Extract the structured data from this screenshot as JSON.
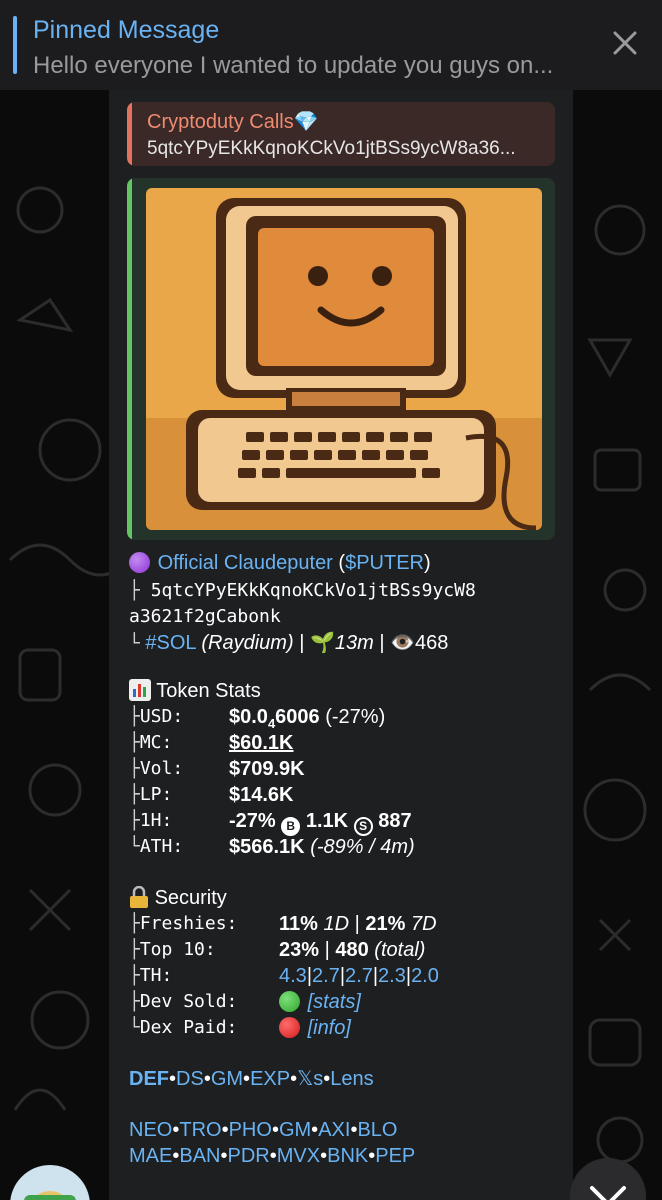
{
  "pinned": {
    "title": "Pinned Message",
    "preview": "Hello everyone I wanted to update you guys on..."
  },
  "reply": {
    "name": "Cryptoduty Calls",
    "text": "5qtcYPyEKkKqnoKCkVo1jtBSs9ycW8a36..."
  },
  "token": {
    "name": "Official Claudeputer",
    "ticker": "$PUTER",
    "address_line1": "5qtcYPyEKkKqnoKCkVo1jtBSs9ycW8",
    "address_line2": "a3621f2gCabonk",
    "chain_tag": "#SOL",
    "dex": "(Raydium)",
    "age": "13m",
    "views": "468"
  },
  "stats": {
    "title": "Token Stats",
    "usd_label": "USD:",
    "usd_value": "$0.0",
    "usd_sub": "4",
    "usd_rest": "6006",
    "usd_change": "(-27%)",
    "mc_label": "MC:",
    "mc_value": "$60.1K",
    "vol_label": "Vol:",
    "vol_value": "$709.9K",
    "lp_label": "LP:",
    "lp_value": "$14.6K",
    "h1_label": "1H:",
    "h1_change": "-27%",
    "h1_buys": "1.1K",
    "h1_sells": "887",
    "ath_label": "ATH:",
    "ath_value": "$566.1K",
    "ath_note": "(-89% / 4m)"
  },
  "security": {
    "title": "Security",
    "freshies_label": "Freshies:",
    "freshies_1d": "11%",
    "freshies_1d_label": "1D",
    "freshies_7d": "21%",
    "freshies_7d_label": "7D",
    "top10_label": "Top 10:",
    "top10_pct": "23%",
    "top10_total": "480",
    "top10_total_label": "(total)",
    "th_label": "TH:",
    "th_values": [
      "4.3",
      "2.7",
      "2.7",
      "2.3",
      "2.0"
    ],
    "dev_sold_label": "Dev Sold:",
    "dev_sold_link": "[stats]",
    "dex_paid_label": "Dex Paid:",
    "dex_paid_link": "[info]"
  },
  "links_row1": [
    "DEF",
    "DS",
    "GM",
    "EXP",
    "𝕏s",
    "Lens"
  ],
  "links_row2": [
    "NEO",
    "TRO",
    "PHO",
    "GM",
    "AXI",
    "BLO"
  ],
  "links_row3": [
    "MAE",
    "BAN",
    "PDR",
    "MVX",
    "BNK",
    "PEP"
  ],
  "colors": {
    "accent": "#6ab3f3",
    "reply_accent": "#e2735e",
    "preview_accent": "#64c564",
    "bubble": "#1e1f21"
  }
}
